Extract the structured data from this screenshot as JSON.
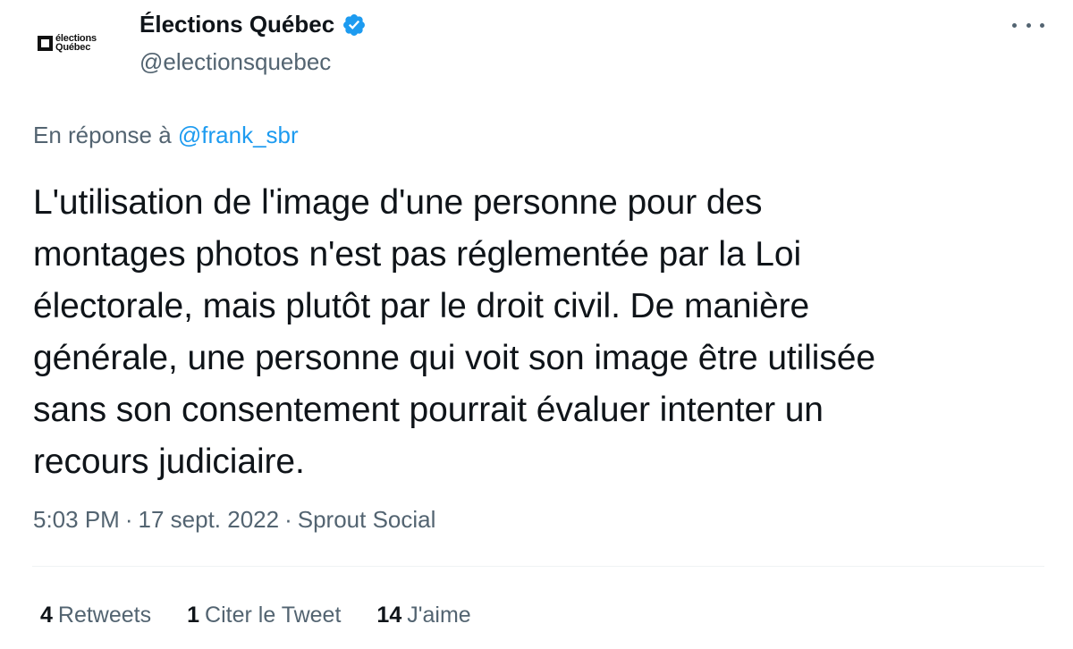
{
  "author": {
    "display_name": "Élections Québec",
    "handle": "@electionsquebec",
    "avatar_logo_lines": [
      "élections",
      "Québec"
    ],
    "verified": true,
    "icons": {
      "verified": "verified-badge-icon",
      "more": "more-options-icon"
    }
  },
  "reply_context": {
    "prefix": "En réponse à",
    "mention": "@frank_sbr"
  },
  "tweet": {
    "lines": [
      "L'utilisation de l'image d'une personne pour des",
      "montages photos n'est pas réglementée par la Loi",
      "électorale, mais plutôt par le droit civil. De manière",
      "générale, une personne qui voit son image être utilisée",
      "sans son consentement pourrait évaluer intenter un",
      "recours judiciaire."
    ]
  },
  "meta": {
    "time": "5:03 PM",
    "date": "17 sept. 2022",
    "source": "Sprout Social",
    "separator": "·"
  },
  "stats": {
    "retweets_count": "4",
    "retweets_label": "Retweets",
    "quotes_count": "1",
    "quotes_label": "Citer le Tweet",
    "likes_count": "14",
    "likes_label": "J'aime"
  },
  "colors": {
    "text_primary": "#0f1419",
    "text_secondary": "#536471",
    "accent": "#1d9bf0",
    "divider": "#eff3f4"
  }
}
